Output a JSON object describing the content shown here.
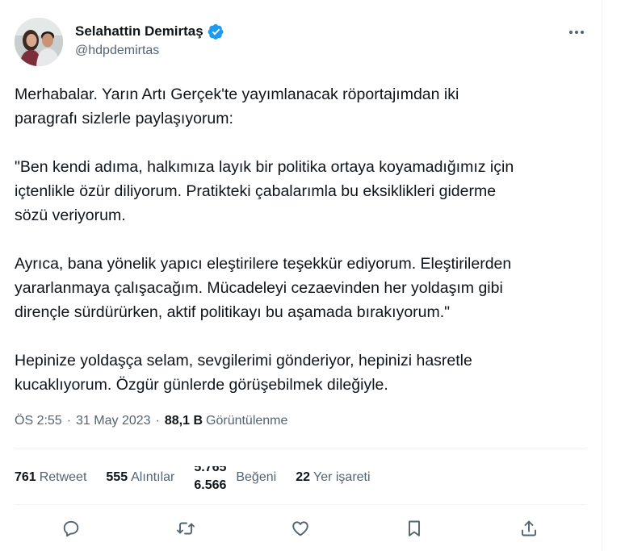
{
  "author": {
    "display_name": "Selahattin Demirtaş",
    "handle": "@hdpdemirtas",
    "verified": true,
    "verified_color": "#1d9bf0"
  },
  "tweet": {
    "lines": [
      "Merhabalar. Yarın Artı Gerçek'te yayımlanacak röportajımdan iki",
      "paragrafı sizlerle paylaşıyorum:",
      "",
      "\"Ben kendi adıma, halkımıza layık bir politika ortaya koyamadığımız için",
      "içtenlikle özür diliyorum. Pratikteki çabalarımla bu eksiklikleri giderme",
      "sözü veriyorum.",
      "",
      "Ayrıca, bana yönelik yapıcı eleştirilere teşekkür ediyorum. Eleştirilerden",
      "yararlanmaya çalışacağım. Mücadeleyi cezaevinden her yoldaşım gibi",
      "dirençle sürdürürken, aktif politikayı bu aşamada bırakıyorum.\"",
      "",
      "Hepinize yoldaşça selam, sevgilerimi gönderiyor, hepinizi hasretle",
      "kucaklıyorum. Özgür günlerde görüşebilmek dileğiyle."
    ]
  },
  "meta": {
    "time": "ÖS 2:55",
    "date": "31 May 2023",
    "separator": "·",
    "views_count": "88,1 B",
    "views_label": "Görüntülenme"
  },
  "stats": {
    "retweets": {
      "count": "761",
      "label": "Retweet"
    },
    "quotes": {
      "count": "555",
      "label": "Alıntılar"
    },
    "likes": {
      "count_old": "5.765",
      "count_new": "6.566",
      "label": "Beğeni"
    },
    "bookmarks": {
      "count": "22",
      "label": "Yer işareti"
    }
  },
  "icons": {
    "more": "more-icon",
    "reply": "reply-icon",
    "retweet": "retweet-icon",
    "like": "heart-icon",
    "bookmark": "bookmark-icon",
    "share": "share-icon"
  },
  "colors": {
    "text_primary": "#0f1419",
    "text_secondary": "#536471",
    "divider": "#eff3f4"
  }
}
